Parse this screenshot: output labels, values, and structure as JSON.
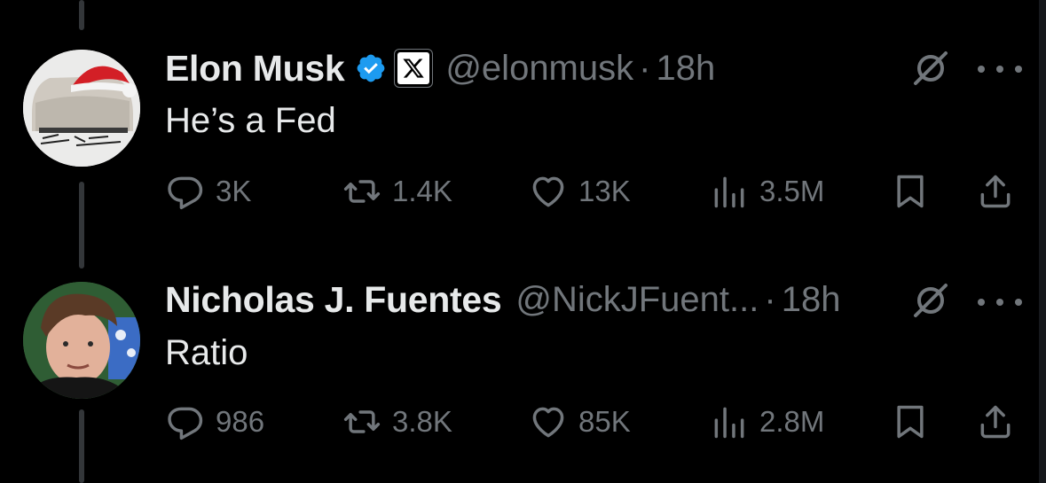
{
  "tweets": [
    {
      "name": "Elon Musk",
      "handle": "@elonmusk",
      "separator": "·",
      "time": "18h",
      "text": "He’s a Fed",
      "verified": true,
      "affiliation_icon": "x-logo-icon",
      "stats": {
        "replies": "3K",
        "reposts": "1.4K",
        "likes": "13K",
        "views": "3.5M"
      }
    },
    {
      "name": "Nicholas J. Fuentes",
      "handle": "@NickJFuent...",
      "separator": "·",
      "time": "18h",
      "text": "Ratio",
      "verified": false,
      "stats": {
        "replies": "986",
        "reposts": "3.8K",
        "likes": "85K",
        "views": "2.8M"
      }
    }
  ],
  "colors": {
    "background": "#000000",
    "text": "#e7e9ea",
    "muted": "#71767b",
    "verified_blue": "#1d9bf0"
  }
}
